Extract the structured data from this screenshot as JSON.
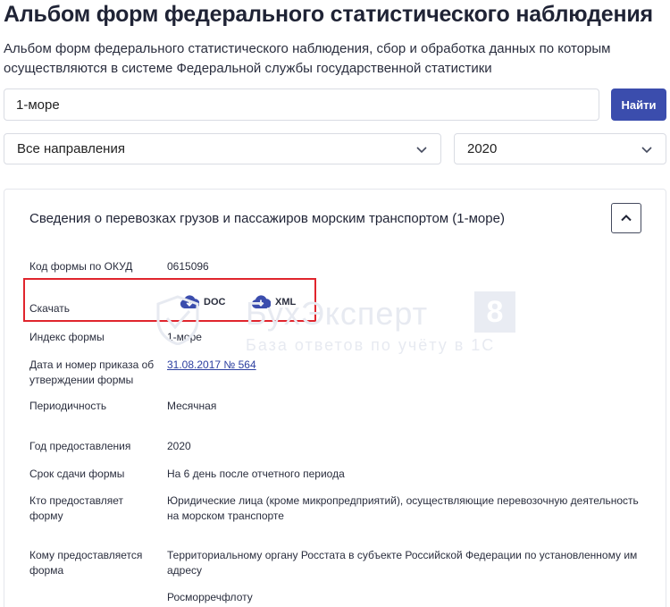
{
  "page": {
    "title": "Альбом форм федерального статистического наблюдения",
    "description": "Альбом форм федерального статистического наблюдения, сбор и обработка данных по которым осуществляются в системе Федеральной службы государственной статистики"
  },
  "search": {
    "value": "1-море",
    "button_label": "Найти"
  },
  "filters": {
    "direction": "Все направления",
    "year": "2020"
  },
  "form_card": {
    "title": "Сведения о перевозках грузов и пассажиров морским транспортом (1-море)",
    "okud_label": "Код формы по ОКУД",
    "okud_value": "0615096",
    "download_label": "Скачать",
    "download_doc": "DOC",
    "download_xml": "XML",
    "index_label": "Индекс формы",
    "index_value": "1-море",
    "order_label": "Дата и номер приказа об утверждении формы",
    "order_value": "31.08.2017 № 564",
    "periodicity_label": "Периодичность",
    "periodicity_value": "Месячная",
    "year_label": "Год предоставления",
    "year_value": "2020",
    "deadline_label": "Срок сдачи формы",
    "deadline_value": "На 6 день после отчетного периода",
    "provider_label": "Кто предоставляет форму",
    "provider_value": "Юридические лица (кроме микропредприятий), осуществляющие перевозочную деятельность на морском транспорте",
    "recipient_label": "Кому предоставляется форма",
    "recipient_value_1": "Территориальному органу Росстата в субъекте Российской Федерации по установленному им адресу",
    "recipient_value_2": "Росморречфлоту"
  },
  "watermark": {
    "name": "БухЭксперт",
    "number": "8",
    "tagline": "База ответов по учёту в 1С"
  },
  "colors": {
    "accent": "#3b4dad",
    "highlight_border": "#e0252d",
    "link": "#2c3fa0"
  },
  "icons": {
    "select_chevron": "chevron-down-icon",
    "collapse": "chevron-up-icon",
    "download": "cloud-download-icon",
    "watermark_logo": "shield-icon"
  }
}
